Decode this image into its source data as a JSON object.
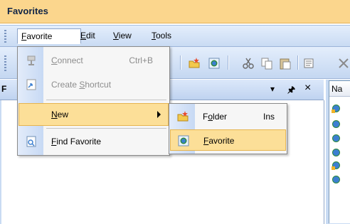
{
  "window": {
    "title": "Favorites"
  },
  "menubar": {
    "items": [
      "Favorite",
      "Edit",
      "View",
      "Tools"
    ]
  },
  "favorite_menu": {
    "items": [
      {
        "label": "Connect",
        "shortcut": "Ctrl+B",
        "disabled": true
      },
      {
        "label": "Create Shortcut",
        "disabled": true
      },
      {
        "label": "New",
        "has_submenu": true,
        "highlighted": true
      },
      {
        "label": "Find Favorite"
      }
    ]
  },
  "new_submenu": {
    "items": [
      {
        "label": "Folder",
        "shortcut": "Ins"
      },
      {
        "label": "Favorite",
        "highlighted": true
      }
    ]
  },
  "pane": {
    "title_initial": "F",
    "pin_glyph": "·2",
    "close_glyph": "×",
    "dropdown_glyph": "▾"
  },
  "right_list": {
    "header": "Na"
  },
  "colors": {
    "accent": "#fcdf98",
    "menubar": "#c9dbf3",
    "titlebar": "#fbd68d"
  }
}
